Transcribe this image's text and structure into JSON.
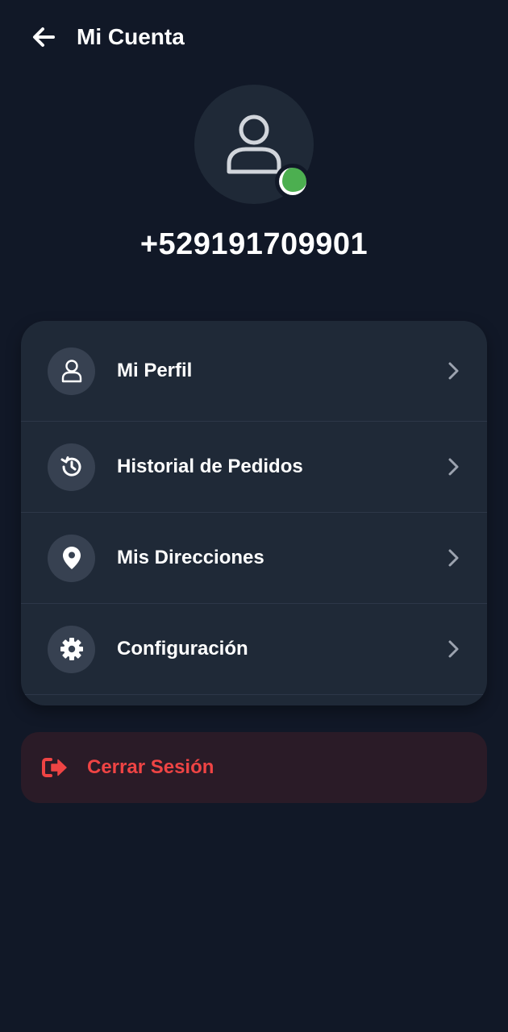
{
  "header": {
    "title": "Mi Cuenta",
    "back_icon": "arrow-left-icon"
  },
  "profile": {
    "avatar_icon": "user-icon",
    "status": "online",
    "status_color": "#4caf50",
    "phone": "+529191709901"
  },
  "menu": {
    "items": [
      {
        "label": "Mi Perfil",
        "icon": "user-icon"
      },
      {
        "label": "Historial de Pedidos",
        "icon": "history-icon"
      },
      {
        "label": "Mis Direcciones",
        "icon": "location-pin-icon"
      },
      {
        "label": "Configuración",
        "icon": "gear-icon"
      }
    ]
  },
  "logout": {
    "label": "Cerrar Sesión",
    "icon": "logout-icon",
    "color": "#ef4444"
  },
  "colors": {
    "background": "#111827",
    "card": "#1f2937",
    "icon_circle": "#374151"
  }
}
